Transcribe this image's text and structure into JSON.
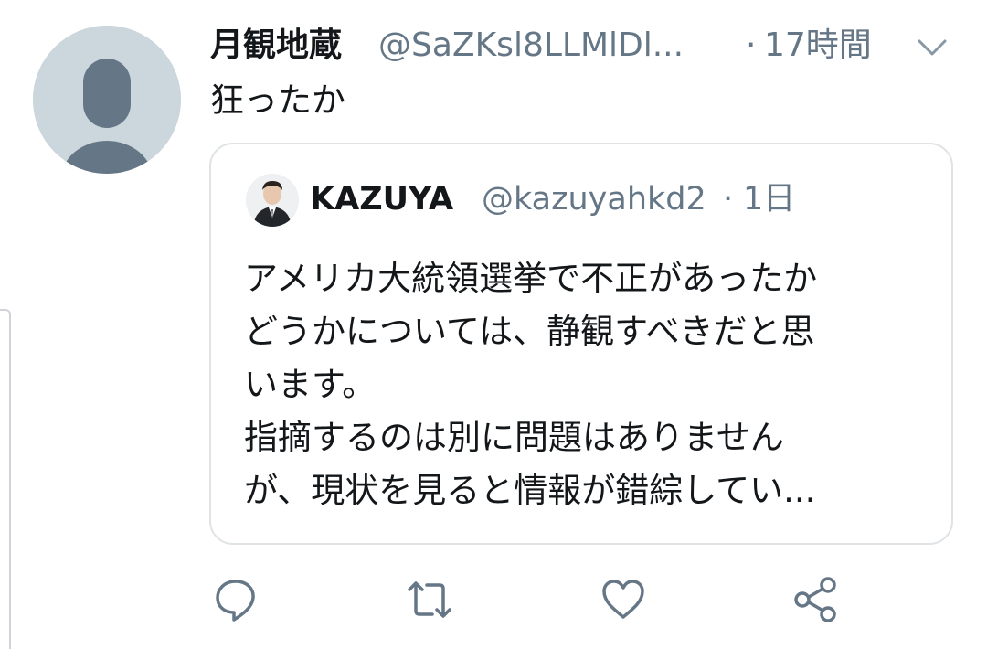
{
  "tweet": {
    "display_name": "月観地蔵",
    "handle": "@SaZKsl8LLMlDl...",
    "separator": "·",
    "time": "17時間",
    "text": "狂ったか",
    "menu_icon": "chevron-down-icon",
    "avatar_icon": "default-profile-icon"
  },
  "quoted_tweet": {
    "display_name": "KAZUYA",
    "handle": "@kazuyahkd2",
    "separator": "·",
    "time": "1日",
    "avatar_icon": "profile-photo-icon",
    "lines": [
      "アメリカ大統領選挙で不正があったか",
      "どうかについては、静観すべきだと思",
      "います。",
      "指摘するのは別に問題はありません",
      "が、現状を見ると情報が錯綜してい..."
    ]
  },
  "actions": {
    "reply_icon": "reply-icon",
    "retweet_icon": "retweet-icon",
    "like_icon": "heart-icon",
    "share_icon": "share-icon"
  },
  "colors": {
    "primary_text": "#14171a",
    "secondary_text": "#657786",
    "border": "#dfe3e6",
    "avatar_bg": "#ccd6dd",
    "avatar_figure": "#657786"
  }
}
